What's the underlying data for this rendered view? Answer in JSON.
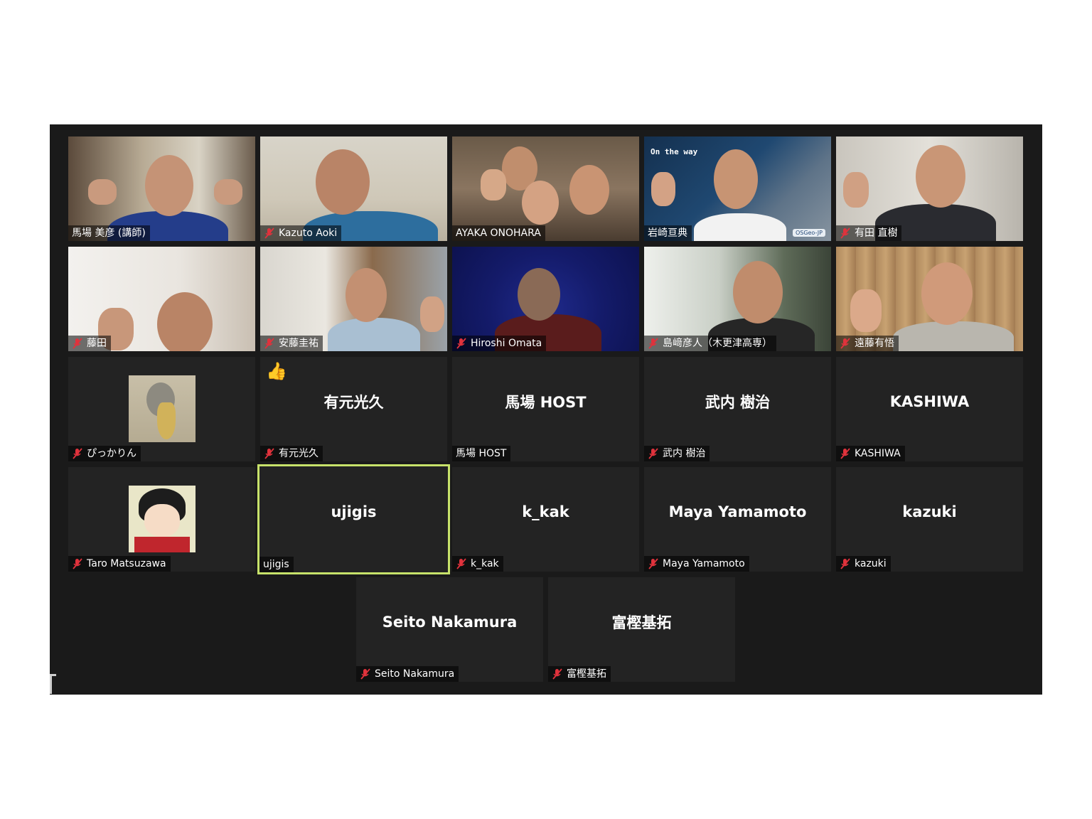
{
  "participants": {
    "row1": [
      {
        "name": "馬場 美彦 (講師)",
        "muted": false
      },
      {
        "name": "Kazuto Aoki",
        "muted": true
      },
      {
        "name": "AYAKA ONOHARA",
        "muted": false
      },
      {
        "name": "岩崎亘典",
        "muted": false,
        "overlay_text": "On the way",
        "overlay_logo": "OSGeo-JP"
      },
      {
        "name": "有田 直樹",
        "muted": true
      }
    ],
    "row2": [
      {
        "name": "藤田",
        "muted": true
      },
      {
        "name": "安藤圭祐",
        "muted": true
      },
      {
        "name": "Hiroshi Omata",
        "muted": true
      },
      {
        "name": "島﨑彦人（木更津高専）",
        "muted": true
      },
      {
        "name": "遠藤有悟",
        "muted": true
      }
    ],
    "row3": [
      {
        "name": "ぴっかりん",
        "muted": true,
        "display": ""
      },
      {
        "name": "有元光久",
        "muted": true,
        "display": "有元光久",
        "reaction": "👍"
      },
      {
        "name": "馬場 HOST",
        "muted": false,
        "display": "馬場 HOST"
      },
      {
        "name": "武内 樹治",
        "muted": true,
        "display": "武内 樹治"
      },
      {
        "name": "KASHIWA",
        "muted": true,
        "display": "KASHIWA"
      }
    ],
    "row4": [
      {
        "name": "Taro Matsuzawa",
        "muted": true,
        "display": ""
      },
      {
        "name": "ujigis",
        "muted": false,
        "display": "ujigis",
        "active_speaker": true
      },
      {
        "name": "k_kak",
        "muted": true,
        "display": "k_kak"
      },
      {
        "name": "Maya Yamamoto",
        "muted": true,
        "display": "Maya Yamamoto"
      },
      {
        "name": "kazuki",
        "muted": true,
        "display": "kazuki"
      }
    ],
    "row5": [
      {
        "name": "Seito Nakamura",
        "muted": true,
        "display": "Seito Nakamura"
      },
      {
        "name": "富樫基拓",
        "muted": true,
        "display": "富樫基拓"
      }
    ]
  },
  "colors": {
    "background": "#1a1a1a",
    "tile": "#232323",
    "active_speaker_border": "#c7e26a",
    "muted_icon": "#e0323c"
  }
}
